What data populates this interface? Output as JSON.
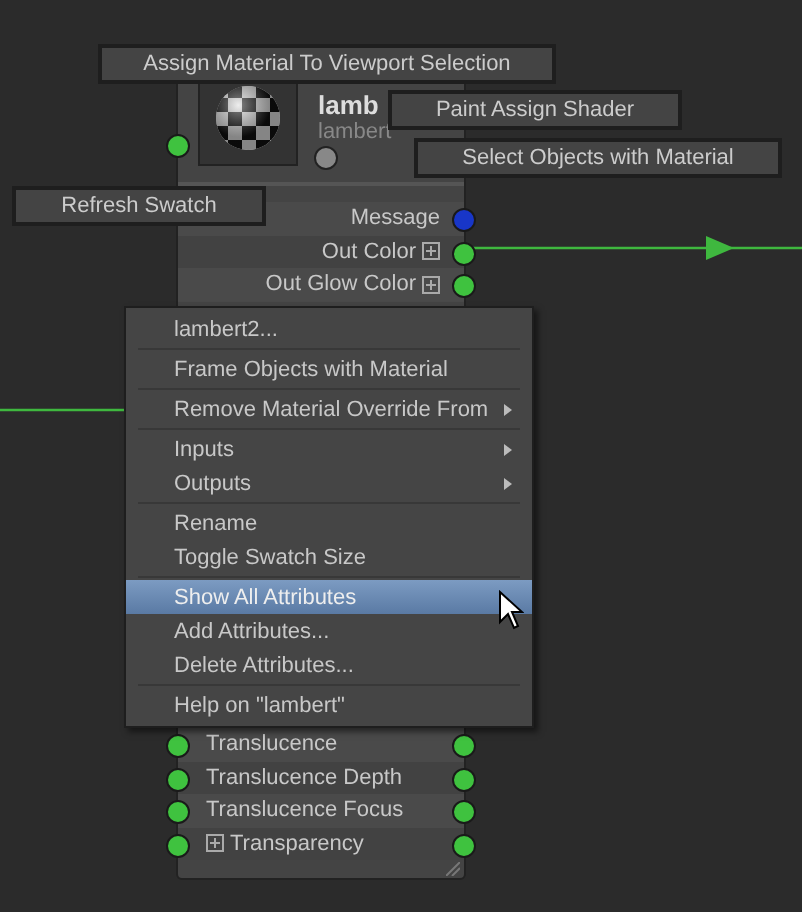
{
  "node": {
    "title": "lamb",
    "subtitle": "lambert",
    "top_rows": [
      {
        "label": "Message",
        "kind": "output",
        "color": "#1836c8",
        "expandable": false
      },
      {
        "label": "Out Color",
        "kind": "output",
        "color": "#3fc23f",
        "expandable": true
      },
      {
        "label": "Out Glow Color",
        "kind": "output",
        "color": "#3fc23f",
        "expandable": true
      }
    ],
    "bottom_rows": [
      {
        "label": "Translucence",
        "kind": "input",
        "color": "#3fc23f",
        "expandable": false
      },
      {
        "label": "Translucence Depth",
        "kind": "input",
        "color": "#3fc23f",
        "expandable": false
      },
      {
        "label": "Translucence Focus",
        "kind": "input",
        "color": "#3fc23f",
        "expandable": false
      },
      {
        "label": "Transparency",
        "kind": "input",
        "color": "#3fc23f",
        "expandable": true
      }
    ]
  },
  "tooltips": [
    {
      "label": "Assign Material To Viewport Selection"
    },
    {
      "label": "Paint Assign Shader"
    },
    {
      "label": "Select Objects with Material"
    },
    {
      "label": "Refresh Swatch"
    }
  ],
  "context_menu": [
    {
      "label": "lambert2...",
      "separator_after": true,
      "submenu": false,
      "selected": false
    },
    {
      "label": "Frame Objects with Material",
      "separator_after": true,
      "submenu": false,
      "selected": false
    },
    {
      "label": "Remove Material Override From",
      "separator_after": true,
      "submenu": true,
      "selected": false
    },
    {
      "label": "Inputs",
      "separator_after": false,
      "submenu": true,
      "selected": false
    },
    {
      "label": "Outputs",
      "separator_after": true,
      "submenu": true,
      "selected": false
    },
    {
      "label": "Rename",
      "separator_after": false,
      "submenu": false,
      "selected": false
    },
    {
      "label": "Toggle Swatch Size",
      "separator_after": true,
      "submenu": false,
      "selected": false
    },
    {
      "label": "Show All Attributes",
      "separator_after": false,
      "submenu": false,
      "selected": true
    },
    {
      "label": "Add Attributes...",
      "separator_after": false,
      "submenu": false,
      "selected": false
    },
    {
      "label": "Delete Attributes...",
      "separator_after": true,
      "submenu": false,
      "selected": false
    },
    {
      "label": "Help on \"lambert\"",
      "separator_after": false,
      "submenu": false,
      "selected": false
    }
  ]
}
